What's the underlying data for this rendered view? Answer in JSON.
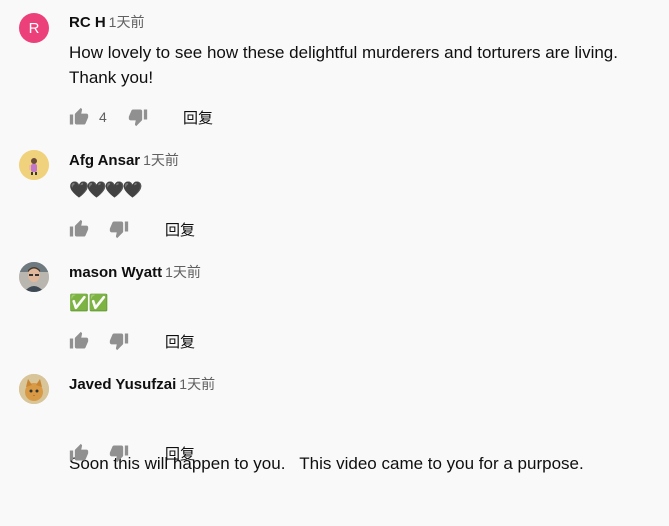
{
  "comments": [
    {
      "author": "RC H",
      "time": "1天前",
      "avatar_letter": "R",
      "lines": [
        "How lovely to see how these delightful murderers and torturers are living.",
        "Thank you!"
      ],
      "likes": "4",
      "reply": "回复"
    },
    {
      "author": "Afg Ansar",
      "time": "1天前",
      "avatar_icon": "cartoon-figure-avatar",
      "content": "🖤🖤🖤🖤",
      "reply": "回复"
    },
    {
      "author": "mason Wyatt",
      "time": "1天前",
      "avatar_icon": "person-photo-avatar",
      "content": "✅✅",
      "reply": "回复"
    },
    {
      "author": "Javed Yusufzai",
      "time": "1天前",
      "avatar_icon": "cat-photo-avatar",
      "lines": [
        "Soon this will happen to you.   This video came to you for a purpose."
      ],
      "reply": "回复"
    }
  ],
  "colors": {
    "background": "#f9f9f9",
    "avatar_r": "#ec407a",
    "icon_gray": "#909090",
    "check_green": "#1ec31e"
  }
}
